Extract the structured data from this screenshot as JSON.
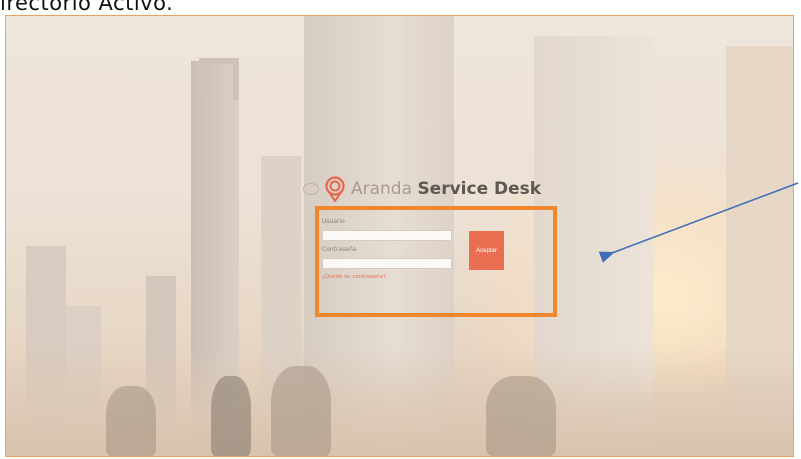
{
  "caption": "irectorio Activo.",
  "brand": {
    "prefix": "Aranda",
    "suffix": "Service Desk"
  },
  "login": {
    "username_label": "Usuario",
    "username_value": "",
    "password_label": "Contraseña",
    "password_value": "",
    "submit_label": "Aceptar",
    "forgot_link": "¿Olvidó su contraseña?"
  },
  "colors": {
    "highlight": "#f0872d",
    "button": "#ea6f52",
    "arrow": "#3e6eb8",
    "link": "#e56f4e"
  },
  "icons": [
    "globe-icon",
    "aranda-logo-icon",
    "arrow-icon"
  ]
}
